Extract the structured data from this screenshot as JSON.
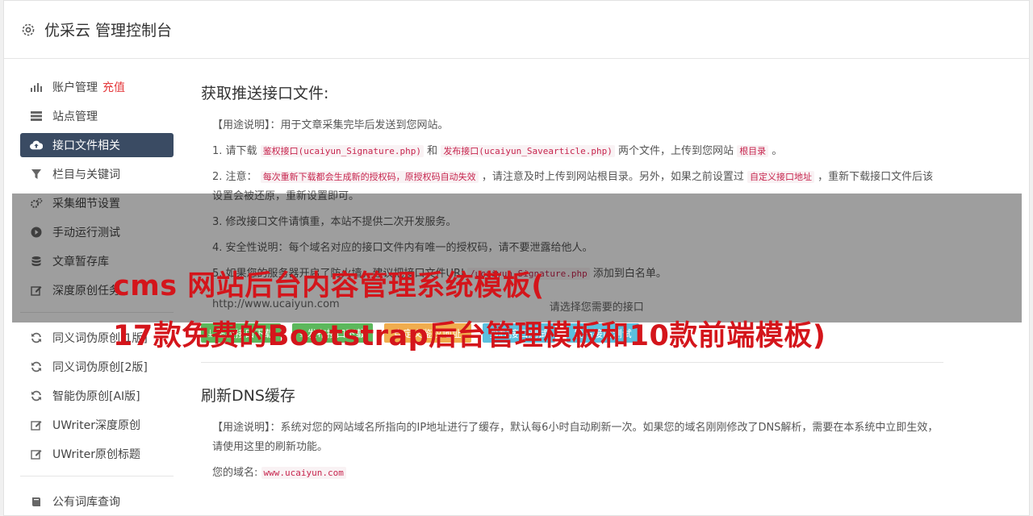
{
  "header": {
    "title": "优采云 管理控制台",
    "icon": "gear-icon"
  },
  "sidebar": {
    "group1": [
      {
        "label": "账户管理",
        "badge": "充值",
        "icon": "bar-chart-icon"
      },
      {
        "label": "站点管理",
        "icon": "server-icon"
      },
      {
        "label": "接口文件相关",
        "icon": "cloud-upload-icon",
        "active": true
      },
      {
        "label": "栏目与关键词",
        "icon": "filter-icon"
      },
      {
        "label": "采集细节设置",
        "icon": "cogs-icon"
      },
      {
        "label": "手动运行测试",
        "icon": "play-icon"
      },
      {
        "label": "文章暂存库",
        "icon": "database-icon"
      },
      {
        "label": "深度原创任务",
        "icon": "edit-icon"
      }
    ],
    "group2": [
      {
        "label": "同义词伪原创[1版]",
        "icon": "refresh-icon"
      },
      {
        "label": "同义词伪原创[2版]",
        "icon": "refresh-icon"
      },
      {
        "label": "智能伪原创[AI版]",
        "icon": "refresh-icon"
      },
      {
        "label": "UWriter深度原创",
        "icon": "edit-icon"
      },
      {
        "label": "UWriter原创标题",
        "icon": "edit-icon"
      }
    ],
    "group3": [
      {
        "label": "公有词库查询",
        "icon": "book-icon"
      }
    ]
  },
  "section1": {
    "title": "获取推送接口文件:",
    "usage": "【用途说明】：用于文章采集完毕后发送到您网站。",
    "p1": {
      "a": "1. 请下载",
      "code1": "鉴权接口(ucaiyun_Signature.php)",
      "b": "和",
      "code2": "发布接口(ucaiyun_Savearticle.php)",
      "c": "两个文件，上传到您网站",
      "code3": "根目录",
      "d": "。"
    },
    "p2": {
      "a": "2. 注意：",
      "code1": "每次重新下载都会生成新的授权码，原授权码自动失效",
      "b": "，请注意及时上传到网站根目录。另外，如果之前设置过",
      "code2": "自定义接口地址",
      "c": "，重新下载接口文件后该设置会被还原，重新设置即可。"
    },
    "p3": "3. 修改接口文件请慎重，本站不提供二次开发服务。",
    "p4": "4. 安全性说明：每个域名对应的接口文件内有唯一的授权码，请不要泄露给他人。",
    "p5": {
      "a": "5. 如果您的服务器开启了防火墙，建议把接口文件URI",
      "code1": "/ucaiyun_Signature.php",
      "b": "添加到白名单。"
    },
    "url_label": "http://www.ucaiyun.com",
    "select_label": "请选择您需要的接口",
    "buttons": {
      "download_auth": "鉴权接口下载",
      "download_publish": "发布接口下载",
      "custom_auth": "自定义鉴权地址",
      "test_auth": "鉴权接口测试",
      "test_publish": "发布接口测试"
    }
  },
  "section2": {
    "title": "刷新DNS缓存",
    "usage": "【用途说明】：系统对您的网站域名所指向的IP地址进行了缓存，默认每6小时自动刷新一次。如果您的域名刚刚修改了DNS解析，需要在本系统中立即生效，请使用这里的刷新功能。",
    "domain_label": "您的域名:",
    "domain_value": "www.ucaiyun.com"
  },
  "banner": {
    "line1": "cms 网站后台内容管理系统模板(",
    "line2": "17款免费的Bootstrap后台管理模板和10款前端模板)"
  },
  "colors": {
    "active_nav": "#3a4b63",
    "banner_text": "#d4151b",
    "green_btn": "#5cb85c",
    "orange_btn": "#f0ad4e",
    "blue_btn": "#5bc0de"
  }
}
